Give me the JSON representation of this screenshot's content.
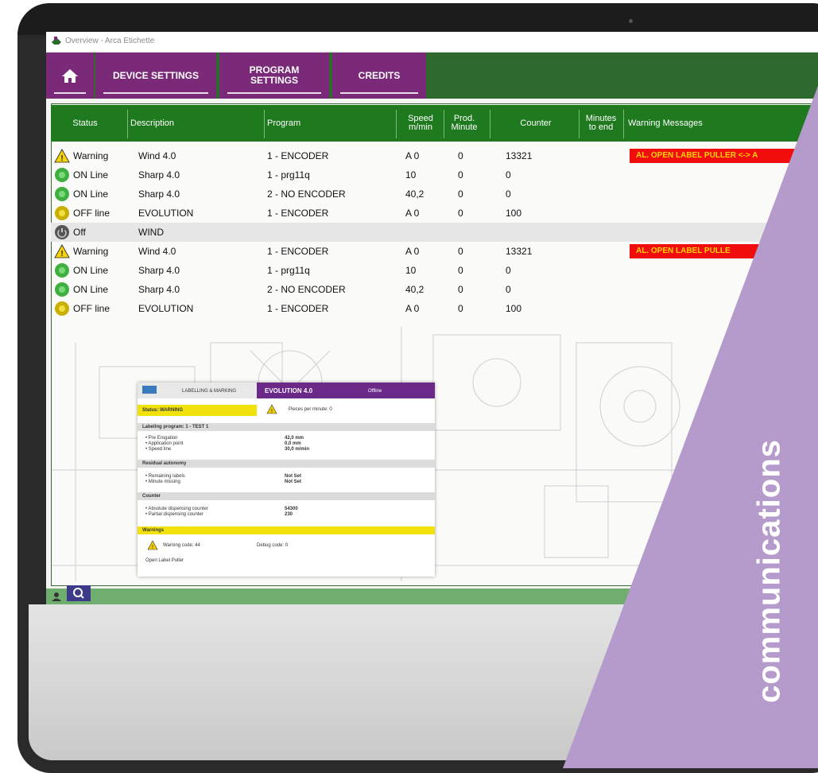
{
  "window": {
    "title": "Overview - Arca Etichette"
  },
  "nav": {
    "home_label": "",
    "device_settings": "DEVICE SETTINGS",
    "program_settings": "PROGRAM SETTINGS",
    "credits": "CREDITS"
  },
  "table": {
    "headers": {
      "status": "Status",
      "description": "Description",
      "program": "Program",
      "speed": "Speed m/min",
      "prod_minute": "Prod. Minute",
      "counter": "Counter",
      "minutes_to_end": "Minutes to end",
      "warning_messages": "Warning Messages"
    },
    "rows": [
      {
        "status": "Warning",
        "description": "Wind 4.0",
        "program": "1 - ENCODER",
        "speed": "A 0",
        "prod": "0",
        "counter": "13321",
        "minutes": "",
        "warning": "AL. OPEN LABEL PULLER <-> A"
      },
      {
        "status": "ON Line",
        "description": "Sharp 4.0",
        "program": "1 - prg11q",
        "speed": "10",
        "prod": "0",
        "counter": "0",
        "minutes": "",
        "warning": ""
      },
      {
        "status": "ON Line",
        "description": "Sharp 4.0",
        "program": "2 - NO ENCODER",
        "speed": "40,2",
        "prod": "0",
        "counter": "0",
        "minutes": "",
        "warning": ""
      },
      {
        "status": "OFF line",
        "description": "EVOLUTION",
        "program": "1 - ENCODER",
        "speed": "A 0",
        "prod": "0",
        "counter": "100",
        "minutes": "",
        "warning": ""
      },
      {
        "status": "Off",
        "description": "WIND",
        "program": "",
        "speed": "",
        "prod": "",
        "counter": "",
        "minutes": "",
        "warning": ""
      },
      {
        "status": "Warning",
        "description": "Wind 4.0",
        "program": "1 - ENCODER",
        "speed": "A 0",
        "prod": "0",
        "counter": "13321",
        "minutes": "",
        "warning": "AL. OPEN LABEL PULLE"
      },
      {
        "status": "ON Line",
        "description": "Sharp 4.0",
        "program": "1 - prg11q",
        "speed": "10",
        "prod": "0",
        "counter": "0",
        "minutes": "",
        "warning": ""
      },
      {
        "status": "ON Line",
        "description": "Sharp 4.0",
        "program": "2 - NO ENCODER",
        "speed": "40,2",
        "prod": "0",
        "counter": "0",
        "minutes": "",
        "warning": ""
      },
      {
        "status": "OFF line",
        "description": "EVOLUTION",
        "program": "1 - ENCODER",
        "speed": "A 0",
        "prod": "0",
        "counter": "100",
        "minutes": "",
        "warning": ""
      }
    ]
  },
  "popup": {
    "logo_caption": "LABELLING & MARKING",
    "device": "EVOLUTION 4.0",
    "header_badge": "Offline",
    "status": "Status: WARNING",
    "pieces_per_minute": "Pieces per minute: 0",
    "program_section": "Labeling program: 1 - TEST 1",
    "program_fields": [
      {
        "label": "• Pre Erogation",
        "value": "42,0 mm"
      },
      {
        "label": "• Application point",
        "value": "0,0 mm"
      },
      {
        "label": "• Speed line",
        "value": "30,0 m/min"
      }
    ],
    "autonomy_section": "Residual autonomy",
    "autonomy_fields": [
      {
        "label": "• Remaining labels",
        "value": "Not Set"
      },
      {
        "label": "• Minute missing",
        "value": "Not Set"
      }
    ],
    "counter_section": "Counter",
    "counter_fields": [
      {
        "label": "• Absolute dispensing counter",
        "value": "54300"
      },
      {
        "label": "• Partial dispensing counter",
        "value": "230"
      }
    ],
    "warnings_section": "Warnings",
    "warning_code": "Warning code: 44",
    "debug_code": "Debug code: 0",
    "warning_text": "Open Label Puller"
  },
  "overlay": {
    "text": "communications"
  },
  "colors": {
    "nav_purple": "#7a2a78",
    "nav_green": "#2e6a2e",
    "header_green": "#1f7a1f",
    "warning_red": "#f20d0d",
    "overlay_lilac": "#b49bcc"
  }
}
